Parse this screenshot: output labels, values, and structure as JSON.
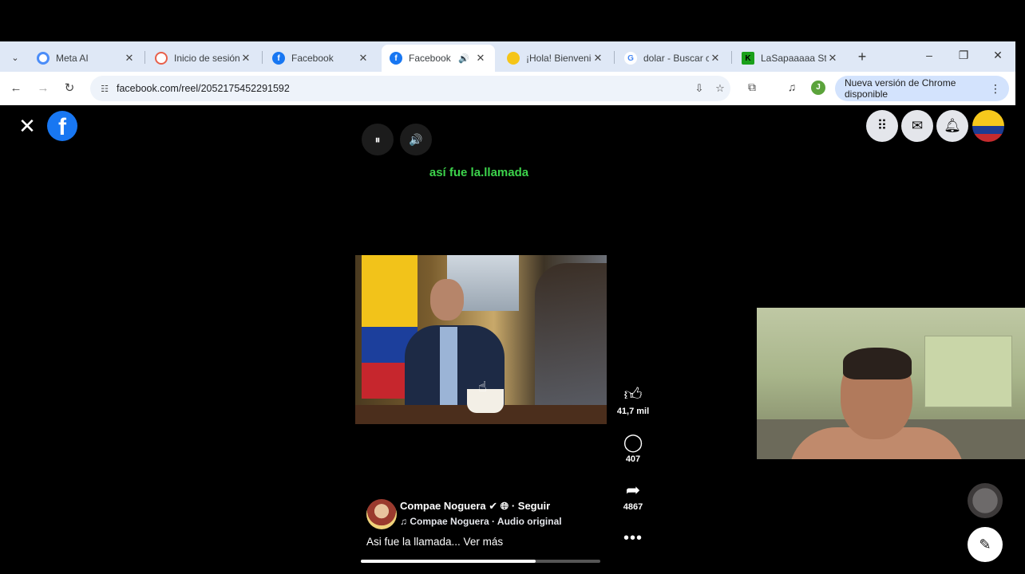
{
  "browser": {
    "tabs": [
      {
        "title": "Meta AI",
        "favicon_color": "#4b8df8",
        "favicon": ""
      },
      {
        "title": "Inicio de sesión",
        "favicon_color": "#e8604a",
        "favicon": ""
      },
      {
        "title": "Facebook",
        "favicon_color": "#1877f2",
        "favicon": "f"
      },
      {
        "title": "Facebook",
        "favicon_color": "#1877f2",
        "favicon": "f",
        "active": true,
        "audio": true
      },
      {
        "title": "¡Hola! Bienvenid",
        "favicon_color": "#f5c518",
        "favicon": ""
      },
      {
        "title": "dolar - Buscar co",
        "favicon_color": "#4285f4",
        "favicon": "G"
      },
      {
        "title": "LaSapaaaaa Stre",
        "favicon_color": "#1aa01a",
        "favicon": "K"
      }
    ],
    "url": "facebook.com/reel/2052175452291592",
    "profile_initial": "J",
    "update_label": "Nueva versión de Chrome disponible"
  },
  "reel": {
    "caption": "así fue la.llamada",
    "likes": "41,7 mil",
    "comments": "407",
    "shares": "4867",
    "author_name": "Compae Noguera",
    "follow_label": "· Seguir",
    "audio_label": "Compae Noguera · Audio original",
    "description": "Asi fue la llamada... Ver más",
    "progress": 0.73
  },
  "icons": {
    "close": "✕",
    "facebook": "f",
    "pause": "⏸",
    "volume": "🔊",
    "menu_grid": "⋮⋮⋮",
    "messenger": "◐",
    "bell": "🔔",
    "like": "👍",
    "comment": "○",
    "share": "➦",
    "more": "•••",
    "compose": "✎"
  }
}
